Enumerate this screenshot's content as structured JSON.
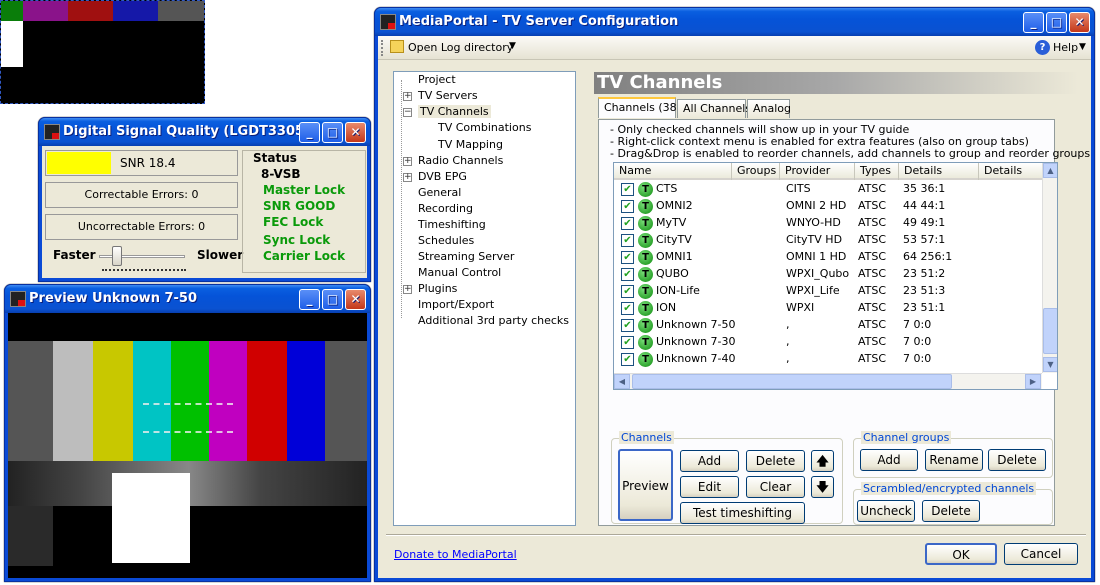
{
  "dsq": {
    "title": "Digital Signal Quality (LGDT3305)",
    "snr": "SNR 18.4",
    "correctable": "Correctable Errors:  0",
    "uncorrectable": "Uncorrectable Errors:  0",
    "faster": "Faster",
    "slower": "Slower",
    "status_label": "Status",
    "status_items": [
      "8-VSB",
      "Master Lock",
      "SNR GOOD",
      "FEC Lock",
      "Sync Lock",
      "Carrier Lock"
    ],
    "colors": {
      "snr_bar": "#ffff00",
      "status_ok": "#0a9a0a"
    }
  },
  "preview": {
    "title": "Preview Unknown 7-50"
  },
  "main": {
    "title": "MediaPortal - TV Server Configuration",
    "toolbar": {
      "open_log": "Open Log directory",
      "help": "Help"
    },
    "tree": [
      "Project",
      "TV Servers",
      "TV Channels",
      "TV Combinations",
      "TV Mapping",
      "Radio Channels",
      "DVB EPG",
      "General",
      "Recording",
      "Timeshifting",
      "Schedules",
      "Streaming Server",
      "Manual Control",
      "Plugins",
      "Import/Export",
      "Additional 3rd party checks"
    ],
    "page_title": "TV Channels",
    "tabs": [
      "Channels (38)",
      "All Channels",
      "Analog"
    ],
    "info": [
      "- Only checked channels will show up in your TV guide",
      "- Right-click context menu is enabled for extra features (also on group tabs)",
      "- Drag&Drop is enabled to reorder channels, add channels to group and reorder groups"
    ],
    "columns": [
      "Name",
      "Groups",
      "Provider",
      "Types",
      "Details",
      "Details"
    ],
    "channels": [
      {
        "name": "CTS",
        "provider": "CITS",
        "type": "ATSC",
        "details": "35 36:1"
      },
      {
        "name": "OMNI2",
        "provider": "OMNI 2 HD",
        "type": "ATSC",
        "details": "44 44:1"
      },
      {
        "name": "MyTV",
        "provider": "WNYO-HD",
        "type": "ATSC",
        "details": "49 49:1"
      },
      {
        "name": "CityTV",
        "provider": "CityTV HD",
        "type": "ATSC",
        "details": "53 57:1"
      },
      {
        "name": "OMNI1",
        "provider": "OMNI 1 HD",
        "type": "ATSC",
        "details": "64 256:1"
      },
      {
        "name": "QUBO",
        "provider": "WPXI_Qubo",
        "type": "ATSC",
        "details": "23 51:2"
      },
      {
        "name": "ION-Life",
        "provider": "WPXI_Life",
        "type": "ATSC",
        "details": "23 51:3"
      },
      {
        "name": "ION",
        "provider": "WPXI",
        "type": "ATSC",
        "details": "23 51:1"
      },
      {
        "name": "Unknown 7-50",
        "provider": ",",
        "type": "ATSC",
        "details": "7 0:0"
      },
      {
        "name": "Unknown 7-30",
        "provider": ",",
        "type": "ATSC",
        "details": "7 0:0"
      },
      {
        "name": "Unknown 7-40",
        "provider": ",",
        "type": "ATSC",
        "details": "7 0:0"
      }
    ],
    "channels_group": {
      "label": "Channels",
      "preview": "Preview",
      "add": "Add",
      "delete": "Delete",
      "edit": "Edit",
      "clear": "Clear",
      "test": "Test timeshifting"
    },
    "channel_groups": {
      "label": "Channel groups",
      "add": "Add",
      "rename": "Rename",
      "delete": "Delete"
    },
    "scrambled": {
      "label": "Scrambled/encrypted channels",
      "uncheck": "Uncheck",
      "delete": "Delete"
    },
    "donate": "Donate to MediaPortal",
    "ok": "OK",
    "cancel": "Cancel"
  }
}
